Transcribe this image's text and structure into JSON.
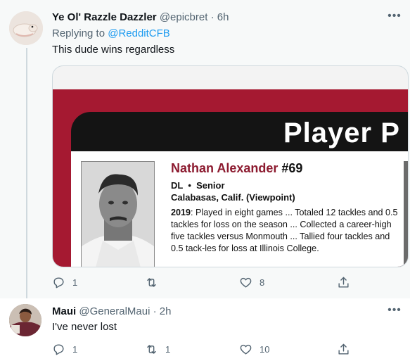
{
  "tweets": [
    {
      "display_name": "Ye Ol' Razzle Dazzler",
      "handle": "@epicbret",
      "separator": "·",
      "time": "6h",
      "replying_label": "Replying to",
      "replying_to": "@RedditCFB",
      "text": "This dude wins regardless",
      "media": {
        "title": "Player P",
        "player_name": "Nathan Alexander",
        "player_number": "#69",
        "position_line": "DL  •  Senior",
        "hometown": "Calabasas, Calif. (Viewpoint)",
        "bio_year": "2019",
        "bio_text": ": Played in eight games ... Totaled 12 tackles and 0.5 tackles for loss on the season ... Collected a career-high five tackles versus Monmouth ... Tallied four tackles and 0.5 tack-les for loss at Illinois College."
      },
      "actions": {
        "reply": "1",
        "retweet": "",
        "like": "8"
      }
    },
    {
      "display_name": "Maui",
      "handle": "@GeneralMaui",
      "separator": "·",
      "time": "2h",
      "text": "I've never lost",
      "actions": {
        "reply": "1",
        "retweet": "1",
        "like": "10"
      }
    }
  ],
  "icons": {
    "more": "more-icon",
    "reply": "reply-icon",
    "retweet": "retweet-icon",
    "like": "like-icon",
    "share": "share-icon"
  },
  "colors": {
    "link": "#1d9bf0",
    "muted": "#536471",
    "crimson": "#a51931"
  }
}
